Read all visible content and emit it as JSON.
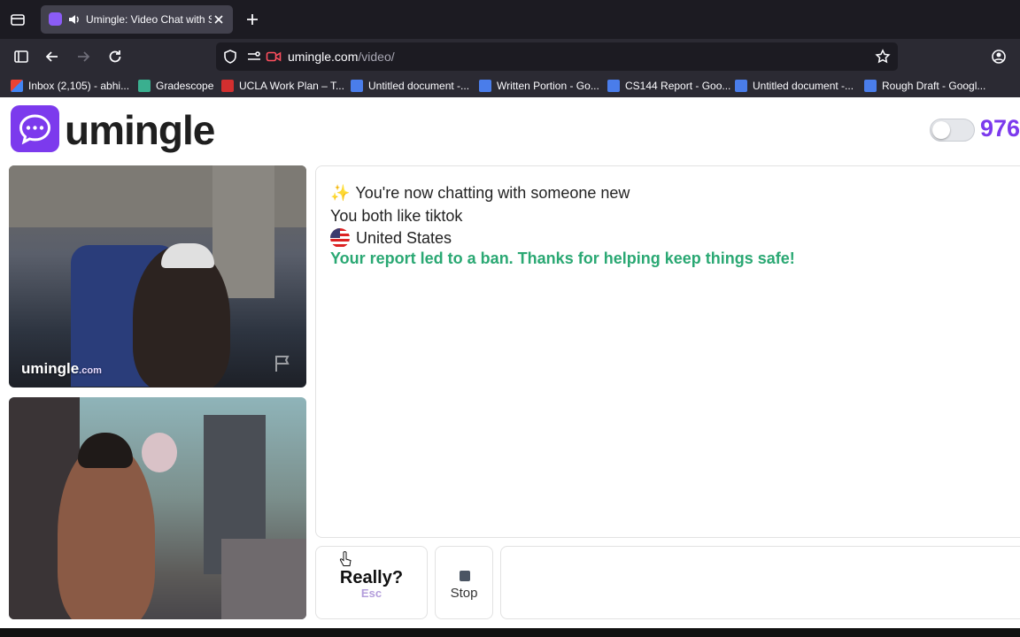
{
  "browser": {
    "tab": {
      "title": "Umingle: Video Chat with Strangers"
    },
    "address": {
      "host": "umingle.com",
      "path": "/video/"
    },
    "bookmarks": [
      {
        "label": "Inbox (2,105) - abhi...",
        "icon": "gmail-icon"
      },
      {
        "label": "Gradescope",
        "icon": "gradescope-icon"
      },
      {
        "label": "UCLA Work Plan – T...",
        "icon": "ucla-icon"
      },
      {
        "label": "Untitled document -...",
        "icon": "docs-icon"
      },
      {
        "label": "Written Portion - Go...",
        "icon": "docs-icon"
      },
      {
        "label": "CS144 Report - Goo...",
        "icon": "docs-icon"
      },
      {
        "label": "Untitled document -...",
        "icon": "docs-icon"
      },
      {
        "label": "Rough Draft - Googl...",
        "icon": "docs-icon"
      }
    ]
  },
  "header": {
    "logo_text": "umingle",
    "online_count": "976"
  },
  "videos": {
    "remote_watermark": "umingle",
    "remote_watermark_suffix": ".com"
  },
  "chat": {
    "intro_icon": "✨",
    "intro": "You're now chatting with someone new",
    "common_interest": "You both like tiktok",
    "country": "United States",
    "report_notice": "Your report led to a ban. Thanks for helping keep things safe!"
  },
  "controls": {
    "skip_label": "Really?",
    "skip_shortcut": "Esc",
    "stop_label": "Stop",
    "message_placeholder": ""
  },
  "colors": {
    "brand": "#7c3aed",
    "success": "#2aa873"
  }
}
